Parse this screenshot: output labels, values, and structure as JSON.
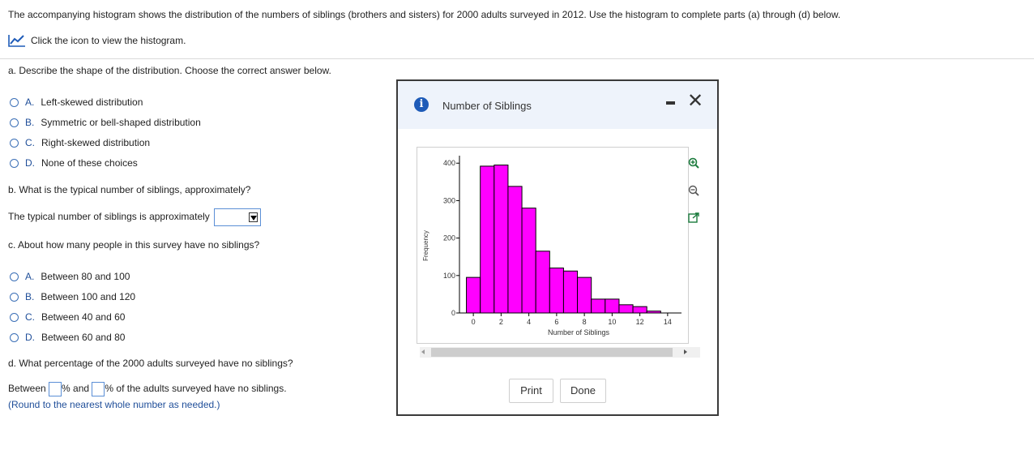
{
  "intro": "The accompanying histogram shows the distribution of the numbers of siblings (brothers and sisters) for 2000 adults surveyed in 2012. Use the histogram to complete parts (a) through (d) below.",
  "icon_link": {
    "label": "Click the icon to view the histogram.",
    "icon": "chart-line-icon"
  },
  "part_a": {
    "question": "a. Describe the shape of the distribution. Choose the correct answer below.",
    "options": [
      {
        "letter": "A.",
        "text": "Left-skewed distribution"
      },
      {
        "letter": "B.",
        "text": "Symmetric or bell-shaped distribution"
      },
      {
        "letter": "C.",
        "text": "Right-skewed distribution"
      },
      {
        "letter": "D.",
        "text": "None of these choices"
      }
    ]
  },
  "part_b": {
    "question": "b. What is the typical number of siblings, approximately?",
    "prompt": "The typical number of siblings is approximately",
    "selected": ""
  },
  "part_c": {
    "question": "c. About how many people in this survey have no siblings?",
    "options": [
      {
        "letter": "A.",
        "text": "Between 80 and 100"
      },
      {
        "letter": "B.",
        "text": "Between 100 and 120"
      },
      {
        "letter": "C.",
        "text": "Between 40 and 60"
      },
      {
        "letter": "D.",
        "text": "Between 60 and 80"
      }
    ]
  },
  "part_d": {
    "question": "d. What percentage of the 2000 adults surveyed have no siblings?",
    "between": "Between",
    "and": "% and",
    "tail": "% of the adults surveyed have no siblings.",
    "note": "(Round to the nearest whole number as needed.)"
  },
  "popup": {
    "title": "Number of Siblings",
    "print_label": "Print",
    "done_label": "Done",
    "header_bg": "#eef3fb",
    "info_color": "#1e5bb8"
  },
  "chart_data": {
    "type": "bar",
    "title": "",
    "xlabel": "Number of Siblings",
    "ylabel": "Frequency",
    "bar_color": "#ff00ff",
    "x_ticks": [
      "0",
      "2",
      "4",
      "6",
      "8",
      "10",
      "12",
      "14"
    ],
    "y_ticks": [
      "0",
      "100",
      "200",
      "300",
      "400"
    ],
    "xlim": [
      -1,
      15
    ],
    "ylim": [
      0,
      420
    ],
    "bins": [
      0,
      1,
      2,
      3,
      4,
      5,
      6,
      7,
      8,
      9,
      10,
      11,
      12,
      13
    ],
    "values": [
      95,
      392,
      395,
      338,
      280,
      165,
      120,
      112,
      95,
      37,
      37,
      22,
      17,
      5
    ],
    "grid": false
  }
}
